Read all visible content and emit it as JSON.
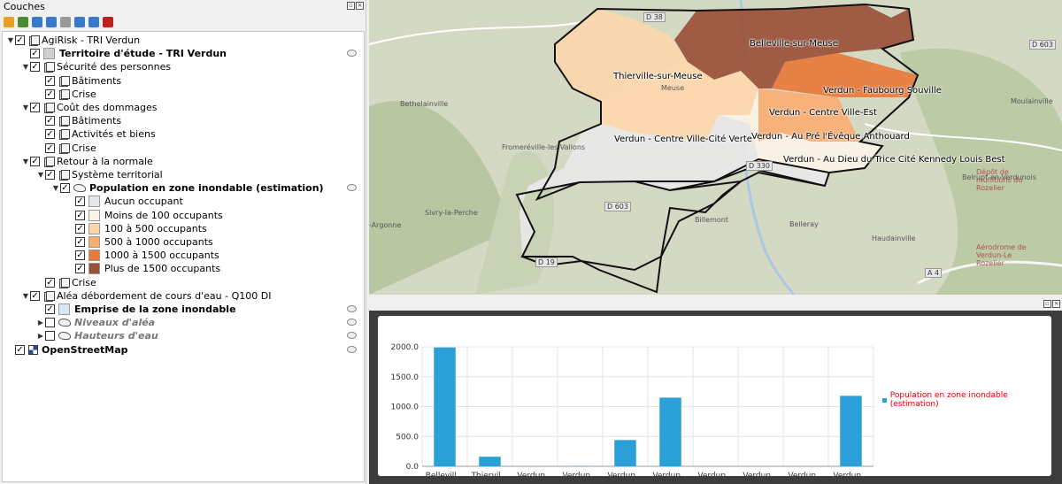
{
  "layers_panel": {
    "title": "Couches",
    "toolbar_icons": [
      "style-brush-icon",
      "add-group-icon",
      "visibility-eye-icon",
      "filter-icon",
      "filter-legend-icon",
      "expand-all-icon",
      "collapse-all-icon",
      "remove-layer-icon"
    ],
    "tree": [
      {
        "label": "AgiRisk - TRI Verdun",
        "kind": "group",
        "checked": true,
        "expanded": true,
        "depth": 0
      },
      {
        "label": "Territoire d'étude - TRI Verdun",
        "kind": "layer",
        "checked": true,
        "depth": 1,
        "bold": true,
        "swatch": "#d0d0d0"
      },
      {
        "label": "Sécurité des personnes",
        "kind": "group",
        "checked": true,
        "expanded": true,
        "depth": 1
      },
      {
        "label": "Bâtiments",
        "kind": "group",
        "checked": true,
        "depth": 2
      },
      {
        "label": "Crise",
        "kind": "group",
        "checked": true,
        "depth": 2
      },
      {
        "label": "Coût des dommages",
        "kind": "group",
        "checked": true,
        "expanded": true,
        "depth": 1
      },
      {
        "label": "Bâtiments",
        "kind": "group",
        "checked": true,
        "depth": 2
      },
      {
        "label": "Activités et biens",
        "kind": "group",
        "checked": true,
        "depth": 2
      },
      {
        "label": "Crise",
        "kind": "group",
        "checked": true,
        "depth": 2
      },
      {
        "label": "Retour à la normale",
        "kind": "group",
        "checked": true,
        "expanded": true,
        "depth": 1
      },
      {
        "label": "Système territorial",
        "kind": "group",
        "checked": true,
        "expanded": true,
        "depth": 2
      },
      {
        "label": "Population en zone inondable (estimation)",
        "kind": "layer",
        "checked": true,
        "expanded": true,
        "depth": 3,
        "bold": true
      },
      {
        "label": "Aucun occupant",
        "kind": "class",
        "checked": true,
        "depth": 4,
        "swatch": "#e8e8e8"
      },
      {
        "label": "Moins de 100 occupants",
        "kind": "class",
        "checked": true,
        "depth": 4,
        "swatch": "#fdf3e7"
      },
      {
        "label": "100 à 500 occupants",
        "kind": "class",
        "checked": true,
        "depth": 4,
        "swatch": "#fbd6ab"
      },
      {
        "label": "500 à 1000 occupants",
        "kind": "class",
        "checked": true,
        "depth": 4,
        "swatch": "#f6ad72"
      },
      {
        "label": "1000 à 1500 occupants",
        "kind": "class",
        "checked": true,
        "depth": 4,
        "swatch": "#e87b3c"
      },
      {
        "label": "Plus de 1500 occupants",
        "kind": "class",
        "checked": true,
        "depth": 4,
        "swatch": "#9a5038"
      },
      {
        "label": "Crise",
        "kind": "group",
        "checked": true,
        "depth": 2
      },
      {
        "label": "Aléa débordement de cours d'eau - Q100 DI",
        "kind": "group",
        "checked": true,
        "expanded": true,
        "depth": 1
      },
      {
        "label": "Emprise de la zone inondable",
        "kind": "layer",
        "checked": true,
        "depth": 2,
        "bold": true,
        "swatch": "#d9e6f5"
      },
      {
        "label": "Niveaux d'aléa",
        "kind": "layer",
        "checked": false,
        "depth": 2,
        "greyed": true
      },
      {
        "label": "Hauteurs d'eau",
        "kind": "layer",
        "checked": false,
        "depth": 2,
        "greyed": true
      },
      {
        "label": "OpenStreetMap",
        "kind": "raster",
        "checked": true,
        "depth": 0,
        "bold": true
      }
    ]
  },
  "map": {
    "zone_labels": [
      "Belleville-sur-Meuse",
      "Thierville-sur-Meuse",
      "Verdun - Faubourg Souville",
      "Verdun - Centre Ville-Est",
      "Verdun - Au Pré l'Évêque Anthouard",
      "Verdun - Centre Ville-Cité Verte",
      "Verdun - Au Dieu du Trice Cité Kennedy Louis Best"
    ],
    "place_names": [
      "Bethelainville",
      "Fromeréville-les-Vallons",
      "Sivry-la-Perche",
      "-Argonne",
      "Moulainville",
      "Belrupt-en-Verdunois",
      "Billemont",
      "Belleray",
      "Haudainville",
      "Dépôt de munitions du Rozelier",
      "Aérodrome de Verdun-Le Rozelier",
      "Meuse"
    ],
    "road_labels": [
      "D 38",
      "D 603",
      "D 603",
      "D 19",
      "D 330",
      "A 4"
    ],
    "colors": {
      "none": "#e8e8e8",
      "lt100": "#fdf3e7",
      "100_500": "#fbd6ab",
      "500_1000": "#f6ad72",
      "1000_1500": "#e87b3c",
      "gt1500": "#9a5038"
    }
  },
  "plot": {
    "legend": "Population en zone inondable (estimation)",
    "color": "#2a9fd8",
    "chart_data": {
      "type": "bar",
      "categories": [
        "Bellevill...",
        "Thiervil...",
        "Verdun...",
        "Verdun...",
        "Verdun...",
        "Verdun...",
        "Verdun...",
        "Verdun...",
        "Verdun...",
        "Verdun..."
      ],
      "series": [
        {
          "name": "Population en zone inondable (estimation)",
          "values": [
            1990,
            160,
            0,
            5,
            440,
            1150,
            0,
            0,
            0,
            1180
          ]
        }
      ],
      "yticks": [
        "0.0",
        "500.0",
        "1000.0",
        "1500.0",
        "2000.0"
      ],
      "ylim": [
        0,
        2000
      ],
      "grid": true,
      "legend_position": "right"
    }
  }
}
